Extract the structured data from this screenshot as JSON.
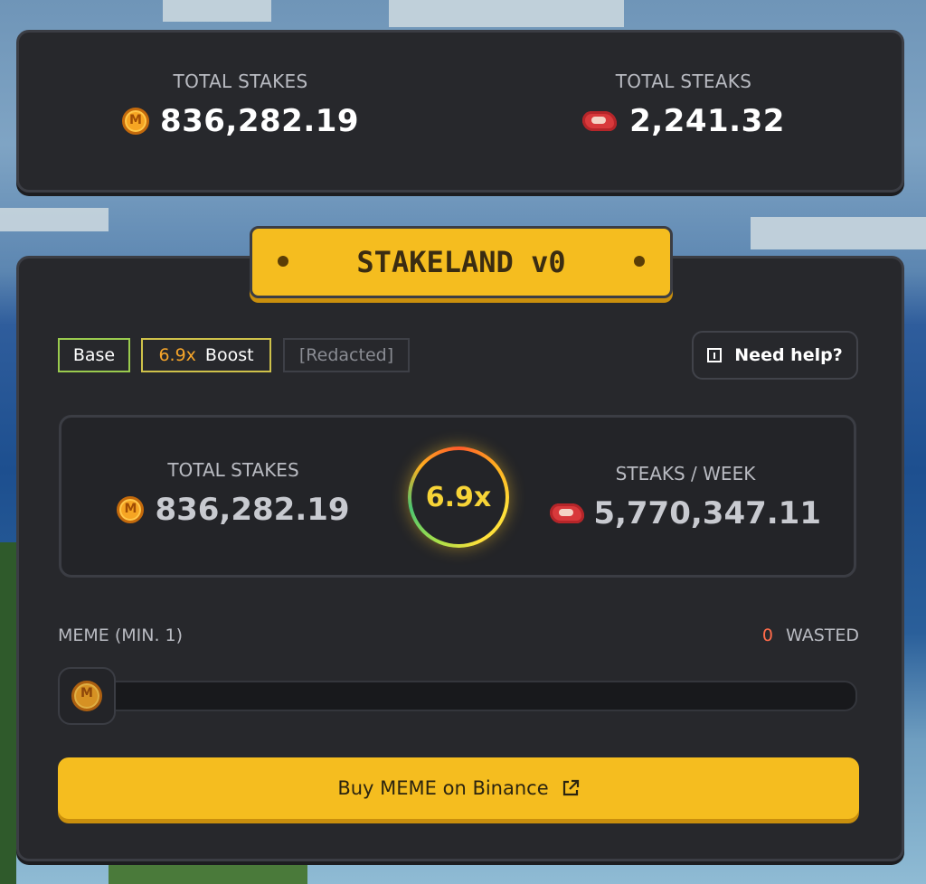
{
  "top_stats": {
    "stakes_label": "TOTAL STAKES",
    "stakes_value": "836,282.19",
    "steaks_label": "TOTAL STEAKS",
    "steaks_value": "2,241.32"
  },
  "title": "STAKELAND v0",
  "chips": {
    "base": "Base",
    "boost_multiplier": "6.9x",
    "boost_label": "Boost",
    "redacted": "[Redacted]"
  },
  "help": {
    "label": "Need help?"
  },
  "inner": {
    "stakes_label": "TOTAL STAKES",
    "stakes_value": "836,282.19",
    "boost": "6.9x",
    "steaks_label": "STEAKS / WEEK",
    "steaks_value": "5,770,347.11"
  },
  "meme": {
    "label": "MEME (MIN. 1)",
    "wasted_count": "0",
    "wasted_label": "WASTED",
    "slider_level": 0
  },
  "buy": {
    "label": "Buy MEME on Binance"
  },
  "colors": {
    "accent": "#f5bd1f",
    "panel": "#27282c",
    "wasted": "#ff6b4a"
  },
  "icons": [
    "meme-coin-icon",
    "steak-icon",
    "info-icon",
    "external-link-icon"
  ]
}
